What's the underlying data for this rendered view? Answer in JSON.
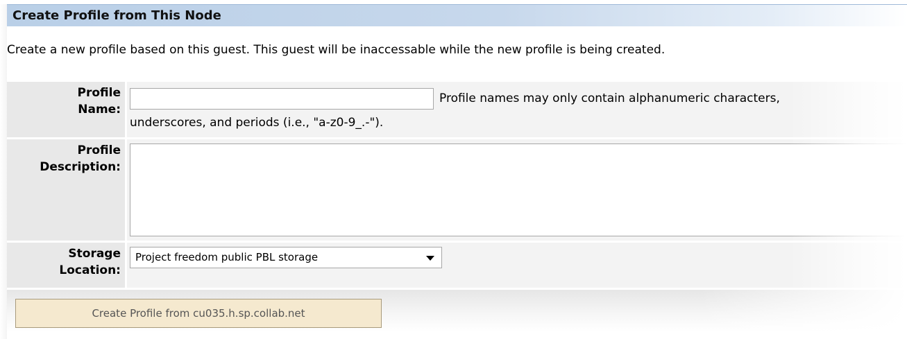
{
  "panel": {
    "title": "Create Profile from This Node",
    "intro": "Create a new profile based on this guest. This guest will be inaccessable while the new profile is being created."
  },
  "form": {
    "profile_name": {
      "label_line1": "Profile",
      "label_line2": "Name:",
      "value": "",
      "hint_line1": "Profile names may only contain alphanumeric characters,",
      "hint_line2": "underscores, and periods (i.e., \"a-z0-9_.-\")."
    },
    "profile_description": {
      "label_line1": "Profile",
      "label_line2": "Description:",
      "value": ""
    },
    "storage_location": {
      "label_line1": "Storage",
      "label_line2": "Location:",
      "selected": "Project freedom public PBL storage"
    }
  },
  "actions": {
    "create_label": "Create Profile from cu035.h.sp.collab.net"
  },
  "colors": {
    "title_bar": "#c7d8ec",
    "label_cell": "#e8e8e8",
    "value_cell": "#f3f3f3",
    "button_bg": "#f5e9cf"
  }
}
